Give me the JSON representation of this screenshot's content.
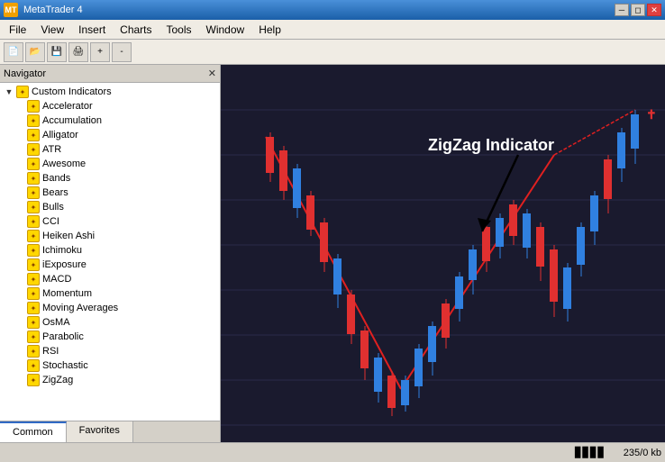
{
  "titleBar": {
    "title": "MetaTrader 4",
    "iconLabel": "MT",
    "controls": [
      "minimize",
      "restore",
      "close"
    ]
  },
  "menuBar": {
    "items": [
      "File",
      "View",
      "Insert",
      "Charts",
      "Tools",
      "Window",
      "Help"
    ]
  },
  "navigator": {
    "title": "Navigator",
    "sections": [
      {
        "label": "Custom Indicators",
        "expanded": true,
        "items": [
          "Accelerator",
          "Accumulation",
          "Alligator",
          "ATR",
          "Awesome",
          "Bands",
          "Bears",
          "Bulls",
          "CCI",
          "Heiken Ashi",
          "Ichimoku",
          "iExposure",
          "MACD",
          "Momentum",
          "Moving Averages",
          "OsMA",
          "Parabolic",
          "RSI",
          "Stochastic",
          "ZigZag"
        ]
      }
    ],
    "tabs": [
      "Common",
      "Favorites"
    ]
  },
  "chart": {
    "annotation": "ZigZag Indicator",
    "background": "#1a1a2e"
  },
  "statusBar": {
    "memoryLabel": "235/0 kb"
  }
}
